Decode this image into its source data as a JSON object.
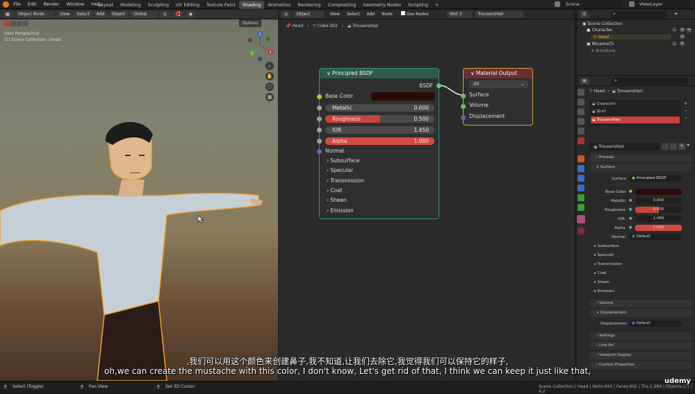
{
  "top_menu": [
    "File",
    "Edit",
    "Render",
    "Window",
    "Help"
  ],
  "workspaces": [
    "Layout",
    "Modeling",
    "Sculpting",
    "UV Editing",
    "Texture Paint",
    "Shading",
    "Animation",
    "Rendering",
    "Compositing",
    "Geometry Nodes",
    "Scripting"
  ],
  "active_workspace": "Shading",
  "scene_label": "Scene",
  "viewlayer_label": "ViewLayer",
  "viewport": {
    "mode": "Object Mode",
    "menus": [
      "View",
      "Select",
      "Add",
      "Object"
    ],
    "transform": "Global",
    "options": "Options",
    "overlay_title": "User Perspective",
    "overlay_sub": "(1) Scene Collection | Head",
    "axis_x": "X",
    "axis_y": "Y",
    "axis_z": "Z"
  },
  "node_editor": {
    "mode": "Object",
    "menus": [
      "View",
      "Select",
      "Add",
      "Node"
    ],
    "use_nodes": "Use Nodes",
    "slot": "Slot 3",
    "material": "TrousersHair",
    "breadcrumb": [
      "Head",
      "Cube.002",
      "TrousersHair"
    ],
    "bsdf": {
      "title": "Principled BSDF",
      "output": "BSDF",
      "base_color": "Base Color",
      "metallic_label": "Metallic",
      "metallic": "0.000",
      "roughness_label": "Roughness",
      "roughness": "0.500",
      "roughness_fill": 0.5,
      "ior_label": "IOR",
      "ior": "1.450",
      "alpha_label": "Alpha",
      "alpha": "1.000",
      "alpha_fill": 1.0,
      "normal": "Normal",
      "panels": [
        "Subsurface",
        "Specular",
        "Transmission",
        "Coat",
        "Sheen",
        "Emission"
      ]
    },
    "output": {
      "title": "Material Output",
      "target": "All",
      "sockets": [
        "Surface",
        "Volume",
        "Displacement"
      ]
    }
  },
  "outliner": {
    "root": "Scene Collection",
    "items": [
      "Character",
      "Head",
      "MixamoCh",
      "Armature"
    ]
  },
  "properties": {
    "breadcrumb": [
      "Head",
      "TrousersHair"
    ],
    "slots": [
      "Character",
      "Shirt",
      "TrousersHair"
    ],
    "material": "TrousersHair",
    "preview": "Preview",
    "surface_panel": "Surface",
    "surface_label": "Surface",
    "surface_value": "Principled BSDF",
    "base_color": "Base Color",
    "metallic_label": "Metallic",
    "metallic": "0.000",
    "roughness_label": "Roughness",
    "roughness": "0.500",
    "ior_label": "IOR",
    "ior": "1.450",
    "alpha_label": "Alpha",
    "alpha": "1.000",
    "normal_label": "Normal",
    "normal_value": "Default",
    "subpanels": [
      "Subsurface",
      "Specular",
      "Transmission",
      "Coat",
      "Sheen",
      "Emission"
    ],
    "volume": "Volume",
    "displacement_panel": "Displacement",
    "displacement_label": "Displacement",
    "displacement_value": "Default",
    "more_panels": [
      "Settings",
      "Line Art",
      "Viewport Display",
      "Custom Properties"
    ]
  },
  "status": {
    "select": "Select (Toggle)",
    "pan": "Pan View",
    "cursor": "Set 3D Cursor",
    "info": "Scene Collection | Head | Verts:994 | Faces:992 | Tris:1,984 | Objects:1/1 | 4.2"
  },
  "subtitles": {
    "zh": ",我们可以用这个颜色来创建鼻子,我不知道,让我们去除它,我觉得我们可以保持它的样子,",
    "en": "oh,we can create the mustache with this color, I don't know, Let's get rid of that, I think we can keep it just like that,"
  },
  "watermark": "udemy",
  "colors": {
    "roughness_bar": "#c8433a",
    "alpha_bar": "#d24a3d",
    "base_color_swatch": "#2a0a08",
    "selection_outline": "#f0a030",
    "socket_yellow": "#c7c729",
    "socket_grey": "#a1a1a1",
    "socket_blue": "#6363c7",
    "socket_green": "#63c763"
  }
}
